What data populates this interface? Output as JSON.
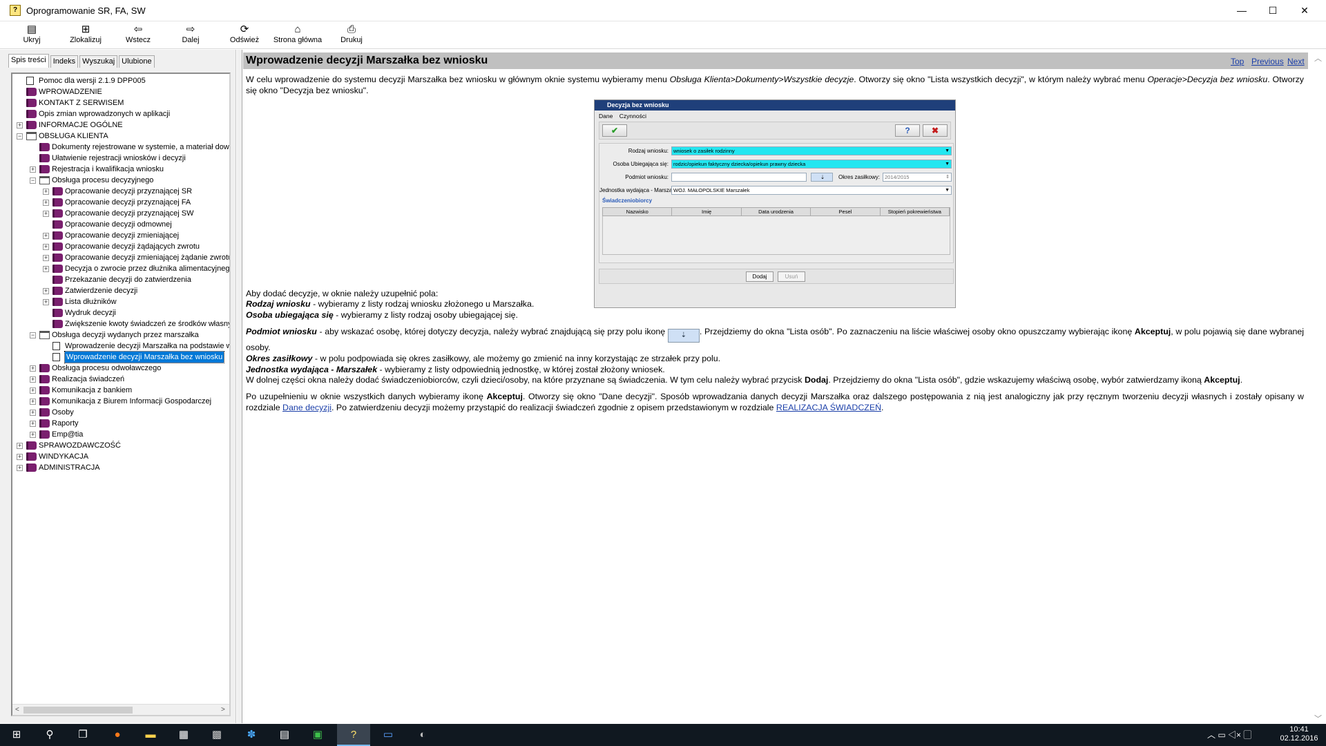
{
  "window": {
    "title": "Oprogramowanie SR, FA, SW",
    "controls": {
      "minimize": "—",
      "maximize": "☐",
      "close": "✕"
    }
  },
  "toolbar": {
    "items": [
      {
        "label": "Ukryj",
        "icon": "hide-icon"
      },
      {
        "label": "Zlokalizuj",
        "icon": "locate-icon"
      },
      {
        "label": "Wstecz",
        "icon": "back-arrow-icon"
      },
      {
        "label": "Dalej",
        "icon": "forward-arrow-icon"
      },
      {
        "label": "Odśwież",
        "icon": "refresh-icon"
      },
      {
        "label": "Strona główna",
        "icon": "home-icon"
      },
      {
        "label": "Drukuj",
        "icon": "printer-icon"
      }
    ]
  },
  "tabs": [
    "Spis treści",
    "Indeks",
    "Wyszukaj",
    "Ulubione"
  ],
  "tree": [
    {
      "label": "Pomoc dla wersji 2.1.9 DPP005",
      "level": 0,
      "icon": "page",
      "exp": ""
    },
    {
      "label": "WPROWADZENIE",
      "level": 0,
      "icon": "book",
      "exp": ""
    },
    {
      "label": "KONTAKT Z SERWISEM",
      "level": 0,
      "icon": "book",
      "exp": ""
    },
    {
      "label": "Opis zmian wprowadzonych w aplikacji",
      "level": 0,
      "icon": "book",
      "exp": ""
    },
    {
      "label": "INFORMACJE OGÓLNE",
      "level": 0,
      "icon": "book",
      "exp": "+"
    },
    {
      "label": "OBSŁUGA KLIENTA",
      "level": 0,
      "icon": "open",
      "exp": "−"
    },
    {
      "label": "Dokumenty rejestrowane w systemie, a materiał dowo",
      "level": 1,
      "icon": "book",
      "exp": ""
    },
    {
      "label": "Ułatwienie rejestracji wniosków i decyzji",
      "level": 1,
      "icon": "book",
      "exp": ""
    },
    {
      "label": "Rejestracja i kwalifikacja wniosku",
      "level": 1,
      "icon": "book",
      "exp": "+"
    },
    {
      "label": "Obsługa procesu decyzyjnego",
      "level": 1,
      "icon": "open",
      "exp": "−"
    },
    {
      "label": "Opracowanie decyzji przyznającej SR",
      "level": 2,
      "icon": "book",
      "exp": "+"
    },
    {
      "label": "Opracowanie decyzji przyznającej FA",
      "level": 2,
      "icon": "book",
      "exp": "+"
    },
    {
      "label": "Opracowanie decyzji przyznającej SW",
      "level": 2,
      "icon": "book",
      "exp": "+"
    },
    {
      "label": "Opracowanie decyzji odmownej",
      "level": 2,
      "icon": "book",
      "exp": ""
    },
    {
      "label": "Opracowanie decyzji zmieniającej",
      "level": 2,
      "icon": "book",
      "exp": "+"
    },
    {
      "label": "Opracowanie decyzji żądających zwrotu",
      "level": 2,
      "icon": "book",
      "exp": "+"
    },
    {
      "label": "Opracowanie decyzji zmieniającej żądanie zwrotu",
      "level": 2,
      "icon": "book",
      "exp": "+"
    },
    {
      "label": "Decyzja o zwrocie przez dłużnika alimentacyjnego",
      "level": 2,
      "icon": "book",
      "exp": "+"
    },
    {
      "label": "Przekazanie decyzji do zatwierdzenia",
      "level": 2,
      "icon": "book",
      "exp": ""
    },
    {
      "label": "Zatwierdzenie decyzji",
      "level": 2,
      "icon": "book",
      "exp": "+"
    },
    {
      "label": "Lista dłużników",
      "level": 2,
      "icon": "book",
      "exp": "+"
    },
    {
      "label": "Wydruk decyzji",
      "level": 2,
      "icon": "book",
      "exp": ""
    },
    {
      "label": "Zwiększenie kwoty świadczeń ze środków własny",
      "level": 2,
      "icon": "book",
      "exp": ""
    },
    {
      "label": "Obsługa decyzji wydanych przez marszałka",
      "level": 1,
      "icon": "open",
      "exp": "−"
    },
    {
      "label": "Wprowadzenie decyzji Marszałka na podstawie w",
      "level": 2,
      "icon": "page",
      "exp": ""
    },
    {
      "label": "Wprowadzenie decyzji Marszałka bez wniosku",
      "level": 2,
      "icon": "page",
      "exp": "",
      "selected": true
    },
    {
      "label": "Obsługa procesu odwoławczego",
      "level": 1,
      "icon": "book",
      "exp": "+"
    },
    {
      "label": "Realizacja świadczeń",
      "level": 1,
      "icon": "book",
      "exp": "+"
    },
    {
      "label": "Komunikacja z bankiem",
      "level": 1,
      "icon": "book",
      "exp": "+"
    },
    {
      "label": "Komunikacja z Biurem Informacji Gospodarczej",
      "level": 1,
      "icon": "book",
      "exp": "+"
    },
    {
      "label": "Osoby",
      "level": 1,
      "icon": "book",
      "exp": "+"
    },
    {
      "label": "Raporty",
      "level": 1,
      "icon": "book",
      "exp": "+"
    },
    {
      "label": "Emp@tia",
      "level": 1,
      "icon": "book",
      "exp": "+"
    },
    {
      "label": "SPRAWOZDAWCZOŚĆ",
      "level": 0,
      "icon": "book",
      "exp": "+"
    },
    {
      "label": "WINDYKACJA",
      "level": 0,
      "icon": "book",
      "exp": "+"
    },
    {
      "label": "ADMINISTRACJA",
      "level": 0,
      "icon": "book",
      "exp": "+"
    }
  ],
  "page": {
    "title": "Wprowadzenie decyzji Marszałka bez wniosku",
    "nav": {
      "top": "Top",
      "previous": "Previous",
      "next": "Next"
    },
    "intro_a": "W celu wprowadzenie do systemu decyzji Marszałka bez wniosku w głównym oknie systemu wybieramy menu ",
    "intro_b": "Obsługa Klienta>Dokumenty>Wszystkie decyzje",
    "intro_c": ". Otworzy się okno \"Lista wszystkich decyzji\", w którym należy wybrać menu ",
    "intro_d": "Operacje>Decyzja bez wniosku",
    "intro_e": ". Otworzy się okno \"Decyzja bez wniosku\".",
    "fields_intro": "Aby dodać decyzje, w oknie należy uzupełnić pola:",
    "f1_b": "Rodzaj wniosku",
    "f1_t": " - wybieramy z listy rodzaj wniosku złożonego u Marszałka.",
    "f2_b": "Osoba ubiegająca się",
    "f2_t": " - wybieramy z listy rodzaj osoby ubiegającej się.",
    "f3_b": "Podmiot wniosku",
    "f3_t1": " - aby wskazać osobę, której dotyczy decyzja, należy wybrać znajdującą się przy polu ikonę ",
    "f3_t2": ". Przejdziemy do okna \"Lista osób\". Po zaznaczeniu na liście właściwej osoby okno opuszczamy wybierając ikonę ",
    "f3_b2": "Akceptuj",
    "f3_t3": ", w polu pojawią się dane wybranej osoby.",
    "f4_b": "Okres zasiłkowy",
    "f4_t": " - w polu podpowiada się okres zasiłkowy, ale możemy go zmienić na inny korzystając ze strzałek przy polu.",
    "f5_b": "Jednostka wydająca - Marszałek",
    "f5_t": " - wybieramy z listy odpowiednią jednostkę, w której został złożony wniosek.",
    "p4_a": "W dolnej części okna należy dodać świadczeniobiorców, czyli dzieci/osoby, na które przyznane są świadczenia. W tym celu należy wybrać przycisk ",
    "p4_b": "Dodaj",
    "p4_c": ". Przejdziemy do okna \"Lista osób\", gdzie wskazujemy właściwą osobę, wybór zatwierdzamy ikoną ",
    "p4_d": "Akceptuj",
    "p4_e": ".",
    "p5_a": "Po uzupełnieniu w oknie wszystkich danych wybieramy ikonę ",
    "p5_b": "Akceptuj",
    "p5_c": ". Otworzy się okno \"Dane decyzji\". Sposób wprowadzania danych decyzji Marszałka oraz dalszego postępowania z nią jest analogiczny jak przy ręcznym tworzeniu decyzji własnych i zostały opisany w rozdziale ",
    "p5_link1": "Dane decyzji",
    "p5_d": ". Po zatwierdzeniu decyzji możemy przystąpić do realizacji świadczeń zgodnie z opisem przedstawionym w rozdziale ",
    "p5_link2": "REALIZACJA ŚWIADCZEŃ",
    "p5_e": "."
  },
  "dialog": {
    "title": "Decyzja bez wniosku",
    "menu": [
      "Dane",
      "Czynności"
    ],
    "labels": {
      "rodzaj": "Rodzaj wniosku:",
      "osoba": "Osoba Ubiegająca się:",
      "podmiot": "Podmiot wniosku:",
      "okres": "Okres zasiłkowy:",
      "jednostka": "Jednostka wydająca - Marszałek:"
    },
    "values": {
      "rodzaj": "wniosek o zasiłek rodzinny",
      "osoba": "rodzic/opiekun faktyczny dziecka/opiekun prawny dziecka",
      "okres": "2014/2015",
      "jednostka": "WOJ. MAŁOPOLSKIE Marszałek"
    },
    "section": "Świadczeniobiorcy",
    "columns": [
      "Nazwisko",
      "Imię",
      "Data urodzenia",
      "Pesel",
      "Stopień pokrewieństwa"
    ],
    "buttons": {
      "dodaj": "Dodaj",
      "usun": "Usuń"
    }
  },
  "taskbar": {
    "time": "10:41",
    "date": "02.12.2016"
  }
}
